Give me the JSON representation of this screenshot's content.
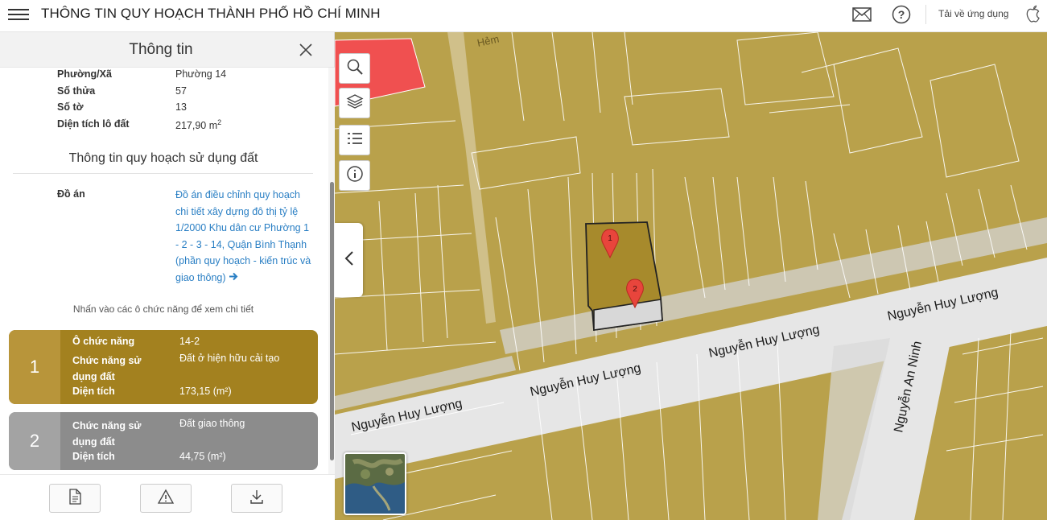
{
  "header": {
    "title": "THÔNG TIN QUY HOẠCH THÀNH PHỐ HỒ CHÍ MINH",
    "download_app": "Tải về ứng dụng",
    "menu_icon": "hamburger-icon",
    "mail_icon": "mail-icon",
    "help_icon": "help-icon",
    "apple_icon": "apple-icon"
  },
  "panel": {
    "title": "Thông tin",
    "info": [
      {
        "label": "Phường/Xã",
        "value": "Phường 14"
      },
      {
        "label": "Số thửa",
        "value": "57"
      },
      {
        "label": "Số tờ",
        "value": "13"
      },
      {
        "label": "Diện tích lô đất",
        "value": "217,90 m",
        "sup": "2"
      }
    ],
    "section_title": "Thông tin quy hoạch sử dụng đất",
    "doan_label": "Đồ án",
    "doan_link": "Đồ án điều chỉnh quy hoạch chi tiết xây dựng đô thị tỷ lệ 1/2000 Khu dân cư Phường 1 - 2 - 3 - 14, Quận Bình Thạnh (phần quy hoạch - kiến trúc và giao thông)",
    "hint": "Nhấn vào các ô chức năng để xem chi tiết",
    "cards": [
      {
        "number": "1",
        "color": "#a3811f",
        "rows": [
          {
            "label": "Ô chức năng",
            "value": "14-2"
          },
          {
            "label": "Chức năng sử dụng đất",
            "value": "Đất ở hiện hữu cải tạo"
          },
          {
            "label": "Diện tích",
            "value": "173,15 (m²)"
          }
        ]
      },
      {
        "number": "2",
        "color": "#8c8c8c",
        "rows": [
          {
            "label": "Chức năng sử dụng đất",
            "value": "Đất giao thông"
          },
          {
            "label": "Diện tích",
            "value": "44,75 (m²)"
          }
        ]
      }
    ]
  },
  "map": {
    "parcel_color": "#b9a14b",
    "road_color": "#e8e8e8",
    "streets": [
      "Nguyễn Huy Lượng",
      "Nguyễn Huy Lượng",
      "Nguyễn Huy Lượng",
      "Nguyễn Huy Lượng",
      "Nguyễn An Ninh",
      "Hẻm"
    ],
    "markers": [
      "1",
      "2"
    ],
    "tools": [
      "search-icon",
      "layers-icon",
      "list-icon",
      "info-icon"
    ]
  }
}
